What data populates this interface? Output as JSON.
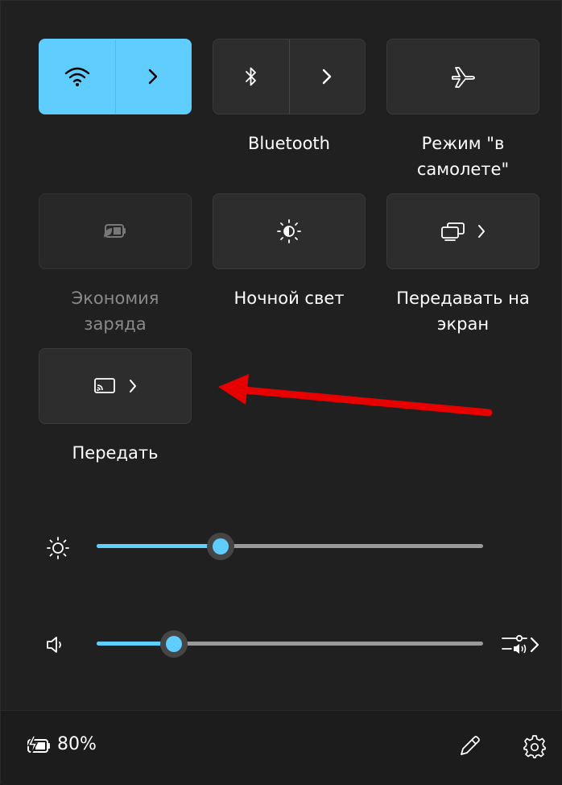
{
  "tiles": {
    "wifi": {
      "label": "",
      "state": "on",
      "icons": [
        "wifi-icon",
        "chevron-right-icon"
      ]
    },
    "bluetooth": {
      "label": "Bluetooth",
      "state": "off",
      "icons": [
        "bluetooth-icon",
        "chevron-right-icon"
      ]
    },
    "airplane": {
      "label_line1": "Режим \"в",
      "label_line2": "самолете\"",
      "state": "off",
      "icons": [
        "airplane-icon"
      ]
    },
    "battery_saver": {
      "label_line1": "Экономия",
      "label_line2": "заряда",
      "state": "disabled",
      "icons": [
        "battery-saver-icon"
      ]
    },
    "night_light": {
      "label": "Ночной свет",
      "state": "off",
      "icons": [
        "night-light-icon"
      ]
    },
    "project": {
      "label_line1": "Передавать на",
      "label_line2": "экран",
      "state": "off",
      "icons": [
        "project-icon",
        "chevron-right-icon"
      ]
    },
    "cast": {
      "label": "Передать",
      "state": "off",
      "icons": [
        "cast-icon",
        "chevron-right-icon"
      ]
    }
  },
  "sliders": {
    "brightness": {
      "value_fraction": 0.32,
      "icon": "brightness-icon"
    },
    "volume": {
      "value_fraction": 0.2,
      "icon": "speaker-icon",
      "trailing_icon": "audio-output-select-icon"
    }
  },
  "footer": {
    "battery_percent": "80%",
    "battery_icon": "battery-charging-icon",
    "edit_icon": "pencil-icon",
    "settings_icon": "gear-icon"
  },
  "annotation": {
    "icon": "red-arrow-annotation"
  },
  "colors": {
    "accent": "#60cdff",
    "panel": "#202020",
    "tile": "#2d2d2d",
    "arrow": "#e60000"
  }
}
